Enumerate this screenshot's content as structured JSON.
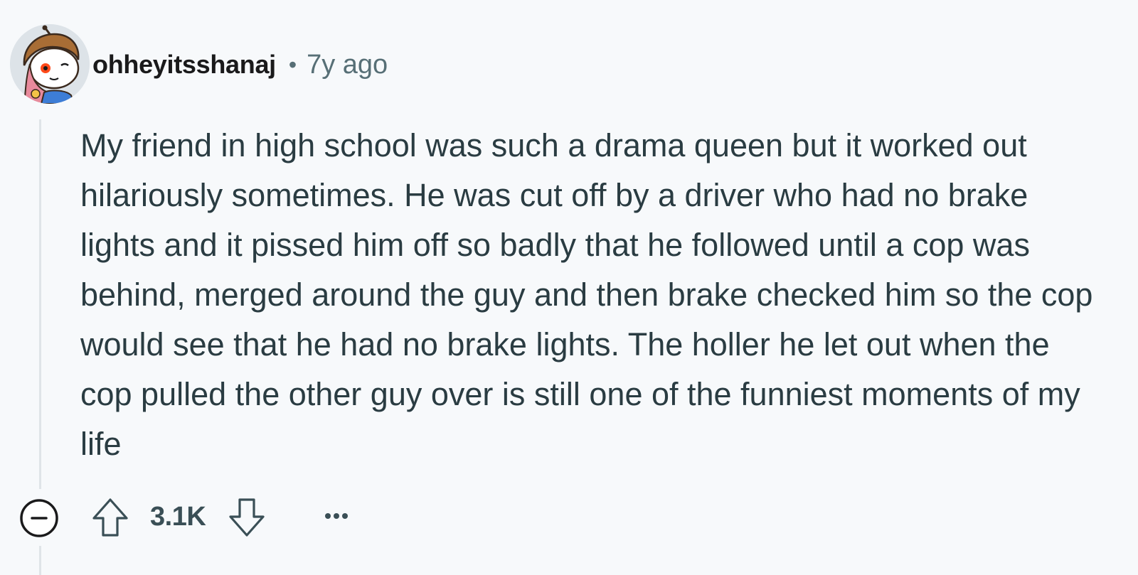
{
  "comment": {
    "username": "ohheyitsshanaj",
    "separator": "•",
    "time_ago": "7y ago",
    "avatar_icon": "snoo-avatar-icon",
    "body": "My friend in high school was such a drama queen but it worked out hilariously sometimes. He was cut off by a driver who had no brake lights and it pissed him off so badly that he followed until a cop was behind, merged around the guy and then brake checked him so the cop would see that he had no brake lights. The holler he let out when the cop pulled the other guy over is still one of the funniest moments of my life"
  },
  "actions": {
    "collapse_icon": "collapse-minus-icon",
    "upvote_icon": "upvote-arrow-icon",
    "score": "3.1K",
    "downvote_icon": "downvote-arrow-icon",
    "more_icon": "more-options-icon"
  },
  "colors": {
    "background": "#f7f9fb",
    "text": "#2a3c42",
    "meta": "#576f76",
    "thread_line": "#dfe4e8"
  }
}
